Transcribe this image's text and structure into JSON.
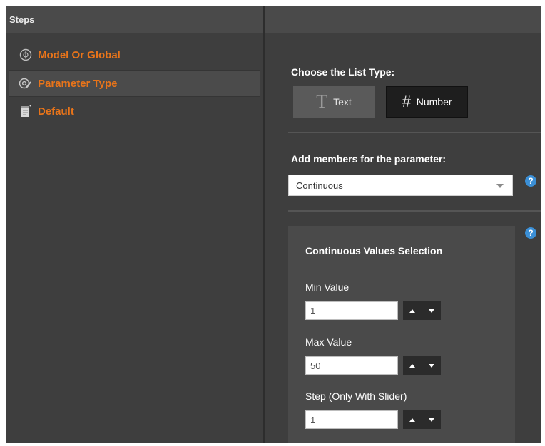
{
  "steps_panel": {
    "title": "Steps",
    "items": [
      {
        "label": "Model Or Global",
        "icon": "model-globe-icon",
        "active": false
      },
      {
        "label": "Parameter Type",
        "icon": "parameter-at-icon",
        "active": true
      },
      {
        "label": "Default",
        "icon": "document-icon",
        "active": false
      }
    ]
  },
  "list_type": {
    "label": "Choose the List Type:",
    "text_option": {
      "glyph": "T",
      "label": "Text"
    },
    "number_option": {
      "glyph": "#",
      "label": "Number",
      "selected": true
    }
  },
  "members": {
    "label": "Add members for the parameter:",
    "selected": "Continuous"
  },
  "help_glyph": "?",
  "continuous": {
    "title": "Continuous Values Selection",
    "min": {
      "label": "Min Value",
      "value": "1"
    },
    "max": {
      "label": "Max Value",
      "value": "50"
    },
    "step": {
      "label": "Step (Only With Slider)",
      "value": "1"
    }
  },
  "colors": {
    "accent_orange": "#e8741a",
    "help_blue": "#3b8fd6",
    "panel_bg": "#3e3e3e"
  }
}
